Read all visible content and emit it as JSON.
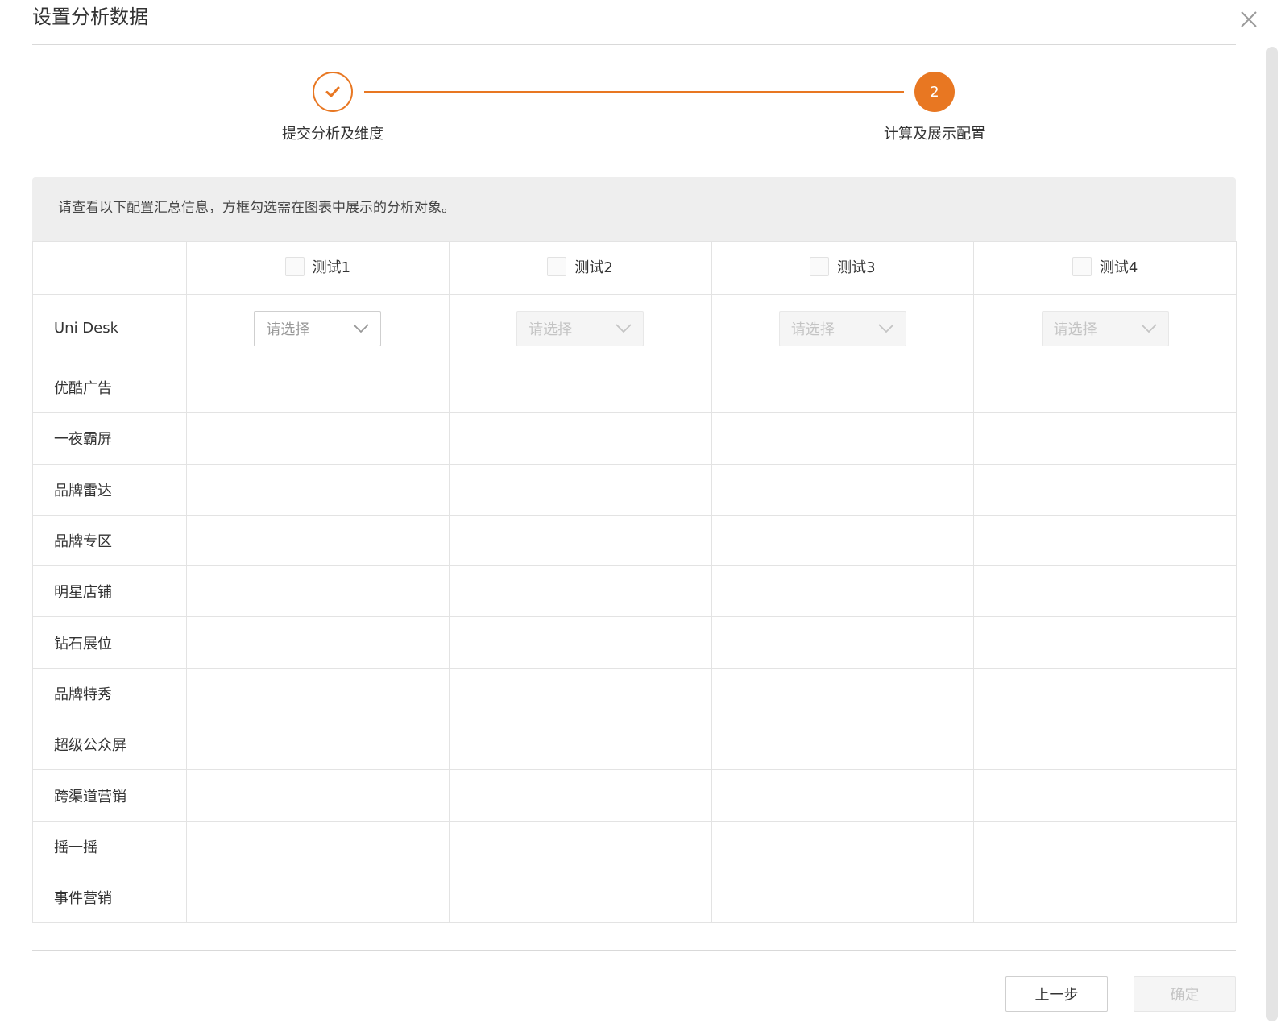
{
  "dialog": {
    "title": "设置分析数据"
  },
  "stepper": {
    "steps": [
      {
        "number": "1",
        "label": "提交分析及维度",
        "status": "completed"
      },
      {
        "number": "2",
        "label": "计算及展示配置",
        "status": "active"
      }
    ],
    "accent_color": "#e87722"
  },
  "info": {
    "text": "请查看以下配置汇总信息，方框勾选需在图表中展示的分析对象。"
  },
  "table": {
    "columns": [
      {
        "label": "测试1",
        "checked": false
      },
      {
        "label": "测试2",
        "checked": false
      },
      {
        "label": "测试3",
        "checked": false
      },
      {
        "label": "测试4",
        "checked": false
      }
    ],
    "select_row": {
      "label": "Uni Desk",
      "placeholder": "请选择",
      "enabled": [
        true,
        false,
        false,
        false
      ]
    },
    "rows": [
      "优酷广告",
      "一夜霸屏",
      "品牌雷达",
      "品牌专区",
      "明星店铺",
      "钻石展位",
      "品牌特秀",
      "超级公众屏",
      "跨渠道营销",
      "摇一摇",
      "事件营销"
    ]
  },
  "footer": {
    "prev_label": "上一步",
    "ok_label": "确定",
    "ok_enabled": false
  }
}
